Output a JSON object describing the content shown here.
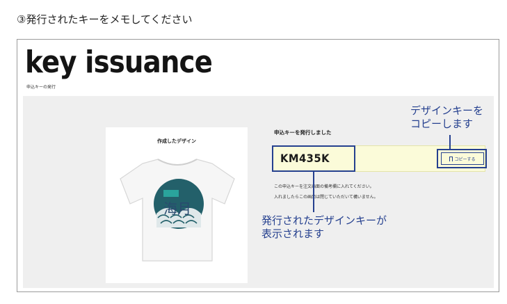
{
  "step_title": "③発行されたキーをメモしてください",
  "page": {
    "heading": "key issuance",
    "subheading": "申込キーの発行"
  },
  "card": {
    "title": "作成したデザイン",
    "design_text": "海月"
  },
  "panel": {
    "title": "申込キーを発行しました",
    "key_value": "KM435K",
    "copy_button_label": "コピーする",
    "note_line1": "この申込キーを注文画面の備考欄に入れてください。",
    "note_line2": "入れましたらこの画面は閉じていただいて構いません。"
  },
  "annotations": {
    "copy_callout_line1": "デザインキーを",
    "copy_callout_line2": "コピーします",
    "key_callout_line1": "発行されたデザインキーが",
    "key_callout_line2": "表示されます"
  },
  "colors": {
    "annotation_blue": "#25408f",
    "key_bar": "#fbfbd9",
    "content_bg": "#efefef",
    "design_teal": "#1f6f73"
  },
  "icons": {
    "copy_button_icon": "bookmark-icon"
  }
}
